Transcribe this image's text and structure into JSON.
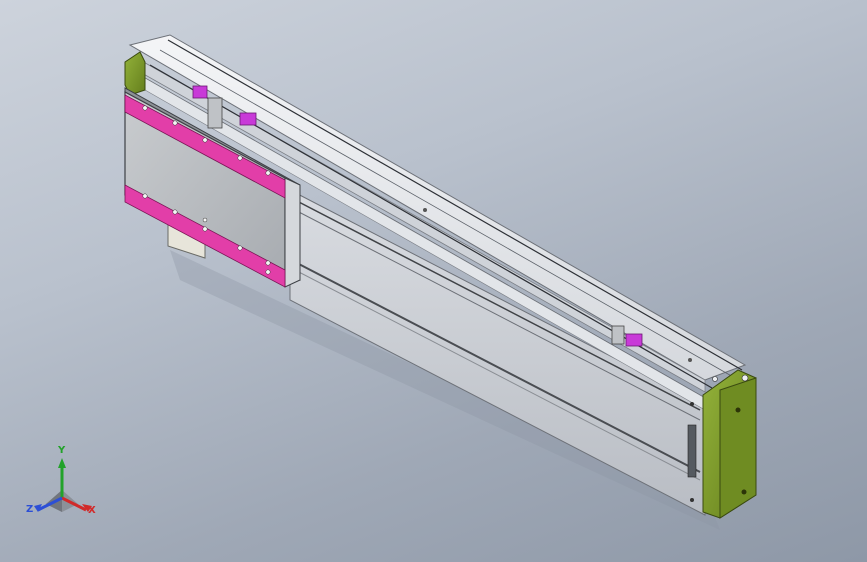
{
  "viewport": {
    "background_top": "#cdd3dc",
    "background_bottom": "#8e98a7"
  },
  "model": {
    "frame_color": "#e7e8ea",
    "end_cap_color": "#7d9a2a",
    "highlight_color": "#e23ea8",
    "marker_color": "#c83ad8"
  },
  "triad": {
    "x_label": "X",
    "y_label": "Y",
    "z_label": "Z",
    "x_color": "#d12a2a",
    "y_color": "#22a22a",
    "z_color": "#2c4fd6"
  }
}
